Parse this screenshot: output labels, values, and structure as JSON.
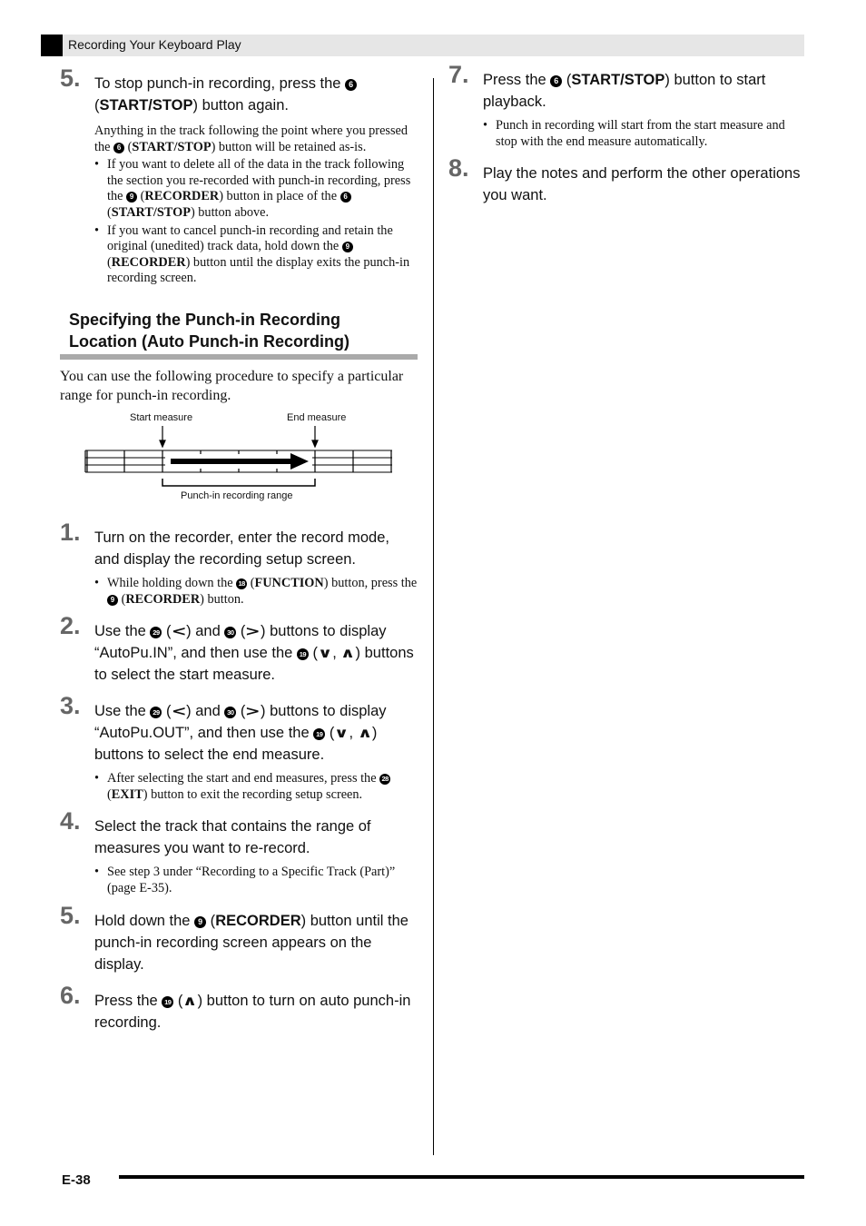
{
  "header": {
    "title": "Recording Your Keyboard Play"
  },
  "left_column": {
    "step5a": {
      "number": "5.",
      "text_1": "To stop punch-in recording, press the",
      "button_6": "6",
      "start_stop": "START/STOP",
      "text_2": ") button again.",
      "note_1": "Anything in the track following the point where you pressed the",
      "note_2": "button will be retained as-is.",
      "bullets": [
        {
          "a": "If you want to delete all of the data in the track following the section you re-recorded with punch-in recording, press the",
          "btn_a": "9",
          "bold_a": "RECORDER",
          "b": ") button in place of the",
          "btn_b": "6",
          "bold_b": "START/STOP",
          "c": ") button above."
        },
        {
          "a": "If you want to cancel punch-in recording and retain the original (unedited) track data, hold down the",
          "btn_a": "9",
          "bold_a": "RECORDER",
          "b": ") button until the display exits the punch-in recording screen."
        }
      ]
    },
    "section": {
      "title_line1": "Specifying the Punch-in Recording",
      "title_line2": "Location (Auto Punch-in Recording)",
      "intro": "You can use the following procedure to specify a particular range for punch-in recording."
    },
    "diagram": {
      "start_label": "Start measure",
      "end_label": "End measure",
      "range_label": "Punch-in recording range"
    },
    "step1": {
      "number": "1.",
      "text": "Turn on the recorder, enter the record mode, and display the recording setup screen.",
      "bullet_a": "While holding down the",
      "btn_18": "18",
      "bold_function": "FUNCTION",
      "bullet_b": ") button, press the",
      "btn_9": "9",
      "bold_recorder": "RECORDER",
      "bullet_c": ") button."
    },
    "step2": {
      "number": "2.",
      "a": "Use the",
      "btn_29": "29",
      "b": ") and",
      "btn_30": "30",
      "c": ") buttons to display “AutoPu.IN”, and then use the",
      "btn_19": "19",
      "d": ") buttons to select the start measure."
    },
    "step3": {
      "number": "3.",
      "a": "Use the",
      "btn_29": "29",
      "b": ") and",
      "btn_30": "30",
      "c": ") buttons to display “AutoPu.OUT”, and then use the",
      "btn_19": "19",
      "d": ") buttons to select the end measure.",
      "bullet_a": "After selecting the start and end measures, press the",
      "btn_28": "28",
      "bold_exit": "EXIT",
      "bullet_b": ") button to exit the recording setup screen."
    },
    "step4": {
      "number": "4.",
      "text": "Select the track that contains the range of measures you want to re-record.",
      "bullet": "See step 3 under “Recording to a Specific Track (Part)” (page E-35)."
    },
    "step5b": {
      "number": "5.",
      "a": "Hold down the",
      "btn_9": "9",
      "bold": "RECORDER",
      "b": ") button until the punch-in recording screen appears on the display."
    },
    "step6": {
      "number": "6.",
      "a": "Press the",
      "btn_19": "19",
      "b": ") button to turn on auto punch-in recording."
    }
  },
  "right_column": {
    "step7": {
      "number": "7.",
      "a": "Press the",
      "btn_6": "6",
      "bold": "START/STOP",
      "b": ") button to start playback.",
      "bullet": "Punch in recording will start from the start measure and stop with the end measure automatically."
    },
    "step8": {
      "number": "8.",
      "text": "Play the notes and perform the other operations you want."
    }
  },
  "footer": {
    "page_number": "E-38"
  }
}
